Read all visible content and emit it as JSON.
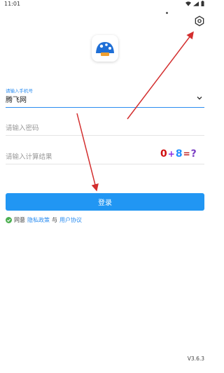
{
  "status_bar": {
    "time": "11:01"
  },
  "form": {
    "field_caption": "请输入手机号",
    "server_value": "腾飞网",
    "password_placeholder": "请输入密码",
    "captcha_placeholder": "请输入计算结果",
    "captcha_chars": [
      "0",
      "+",
      "8",
      "=",
      "?"
    ]
  },
  "login_button": {
    "label": "登录"
  },
  "agreement": {
    "prefix": "同意",
    "privacy_link": "隐私政策",
    "conjunction": "与",
    "terms_link": "用户协议"
  },
  "version": "V3.6.3",
  "colors": {
    "accent": "#2196f3",
    "annotation_arrow": "#d32f2f"
  }
}
